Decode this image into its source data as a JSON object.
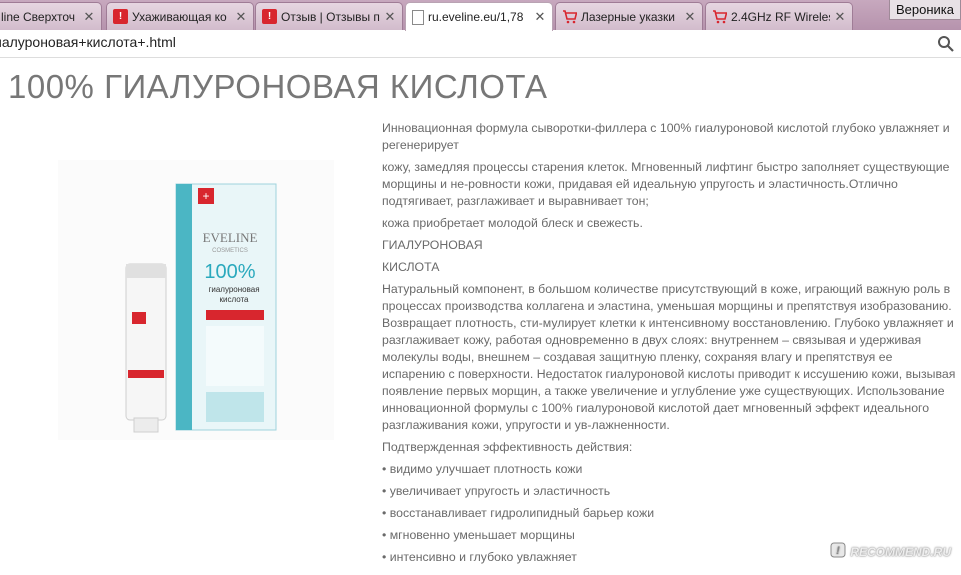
{
  "tabs": [
    {
      "title": "line Сверхточ",
      "icon": "page-icon",
      "active": false
    },
    {
      "title": "Ухаживающая ко",
      "icon": "recommend-icon",
      "active": false
    },
    {
      "title": "Отзыв | Отзывы п",
      "icon": "recommend-icon",
      "active": false
    },
    {
      "title": "ru.eveline.eu/1,78",
      "icon": "page-icon",
      "active": true
    },
    {
      "title": "Лазерные указки",
      "icon": "cart-icon",
      "active": false
    },
    {
      "title": "2.4GHz RF Wireles",
      "icon": "cart-icon",
      "active": false
    }
  ],
  "profile": {
    "name": "Вероника"
  },
  "address": {
    "url": "иалуроновая+кислота+.html"
  },
  "page": {
    "title": "100% ГИАЛУРОНОВАЯ КИСЛОТА",
    "paragraphs": [
      "Инновационная формула сыворотки-филлера с 100% гиалуроновой кислотой глубоко увлажняет и регенерирует",
      "кожу, замедляя процессы старения клеток. Мгновенный лифтинг быстро заполняет существующие морщины и не-ровности кожи, придавая ей идеальную упругость и эластичность.Отлично подтягивает, разглаживает и выравнивает тон;",
      "кожа приобретает молодой блеск и свежесть.",
      "ГИАЛУРОНОВАЯ",
      "КИСЛОТА",
      "Натуральный компонент, в большом количестве присутствующий в коже, играющий важную роль в процессах производства коллагена и эластина, уменьшая морщины и препятствуя изобразованию. Возвращает плотность, сти-мулирует клетки к интенсивному восстановлению. Глубоко увлажняет и разглаживает кожу, работая одновременно в двух слоях: внутреннем – связывая и удерживая молекулы воды, внешнем – создавая защитную пленку, сохраняя влагу и препятствуя ее испарению с поверхности. Недостаток гиалуроновой кислоты приводит к иссушению кожи, вызывая появление первых морщин, а также увеличение и углубление уже существующих. Использование инновационной формулы с 100% гиалуроновой кислотой дает мгновенный эффект идеального разглаживания кожи, упругости и ув-лажненности.",
      "Подтвержденная эффективность действия:"
    ],
    "bullets": [
      "• видимо улучшает плотность кожи",
      "• увеличивает упругость и эластичность",
      "• восстанавливает гидролипидный барьер кожи",
      "• мгновенно уменьшает морщины",
      "• интенсивно и глубоко увлажняет"
    ],
    "product": {
      "brand": "EVELINE",
      "brand_sub": "COSMETICS",
      "percent": "100%",
      "line1": "гиалуроновая",
      "line2": "кислота"
    }
  },
  "watermark": {
    "text": "RECOMMEND.RU"
  }
}
